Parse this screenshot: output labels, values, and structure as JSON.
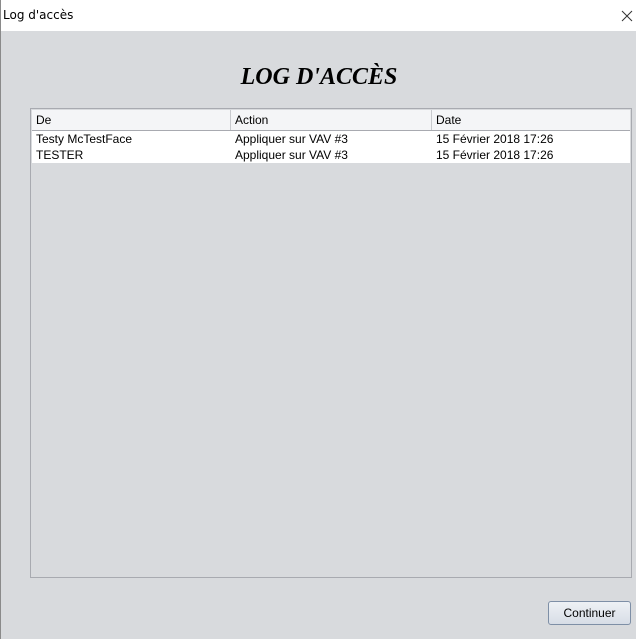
{
  "window": {
    "title": "Log d'accès",
    "close_icon": "close-icon"
  },
  "header": {
    "title": "LOG D'ACCÈS"
  },
  "table": {
    "columns": [
      "De",
      "Action",
      "Date"
    ],
    "rows": [
      [
        "Testy McTestFace",
        "Appliquer sur VAV #3",
        "15 Février 2018 17:26"
      ],
      [
        "TESTER",
        "Appliquer sur VAV #3",
        "15 Février 2018 17:26"
      ]
    ]
  },
  "footer": {
    "continue_label": "Continuer"
  }
}
